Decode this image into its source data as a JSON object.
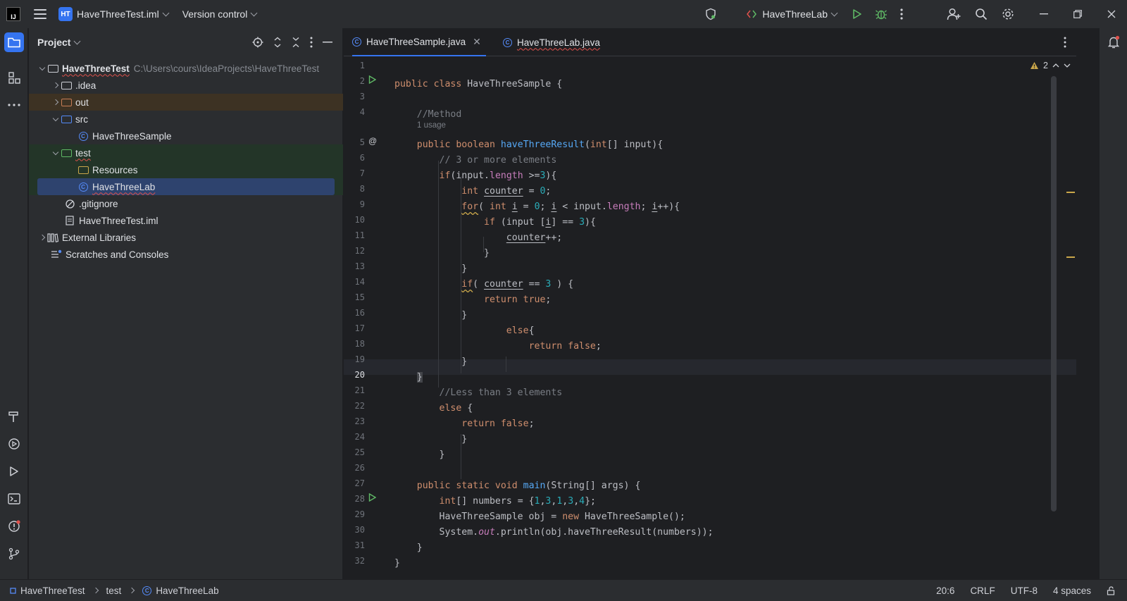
{
  "titlebar": {
    "logo": "IJ",
    "project_badge": "HT",
    "project_name": "HaveThreeTest.iml",
    "vcs_label": "Version control",
    "run_config": "HaveThreeLab"
  },
  "project_panel": {
    "title": "Project",
    "tree": [
      {
        "label": "HaveThreeTest",
        "path": "C:\\Users\\cours\\IdeaProjects\\HaveThreeTest"
      },
      {
        "label": ".idea"
      },
      {
        "label": "out"
      },
      {
        "label": "src"
      },
      {
        "label": "HaveThreeSample"
      },
      {
        "label": "test"
      },
      {
        "label": "Resources"
      },
      {
        "label": "HaveThreeLab"
      },
      {
        "label": ".gitignore"
      },
      {
        "label": "HaveThreeTest.iml"
      },
      {
        "label": "External Libraries"
      },
      {
        "label": "Scratches and Consoles"
      }
    ]
  },
  "editor": {
    "tabs": [
      {
        "label": "HaveThreeSample.java",
        "active": true
      },
      {
        "label": "HaveThreeLab.java",
        "active": false
      }
    ],
    "warning_count": "2",
    "usage_hint": "1 usage",
    "line_numbers": [
      "1",
      "2",
      "3",
      "4",
      "5",
      "6",
      "7",
      "8",
      "9",
      "10",
      "11",
      "12",
      "13",
      "14",
      "15",
      "16",
      "17",
      "18",
      "19",
      "20",
      "21",
      "22",
      "23",
      "24",
      "25",
      "26",
      "27",
      "28",
      "29",
      "30",
      "31",
      "32"
    ]
  },
  "statusbar": {
    "breadcrumbs": [
      "HaveThreeTest",
      "test",
      "HaveThreeLab"
    ],
    "position": "20:6",
    "line_ending": "CRLF",
    "encoding": "UTF-8",
    "indent": "4 spaces"
  },
  "colors": {
    "accent": "#3574f0",
    "keyword": "#cf8e6d",
    "function": "#56a8f5",
    "number": "#2aacb8",
    "comment": "#7a7e85"
  }
}
